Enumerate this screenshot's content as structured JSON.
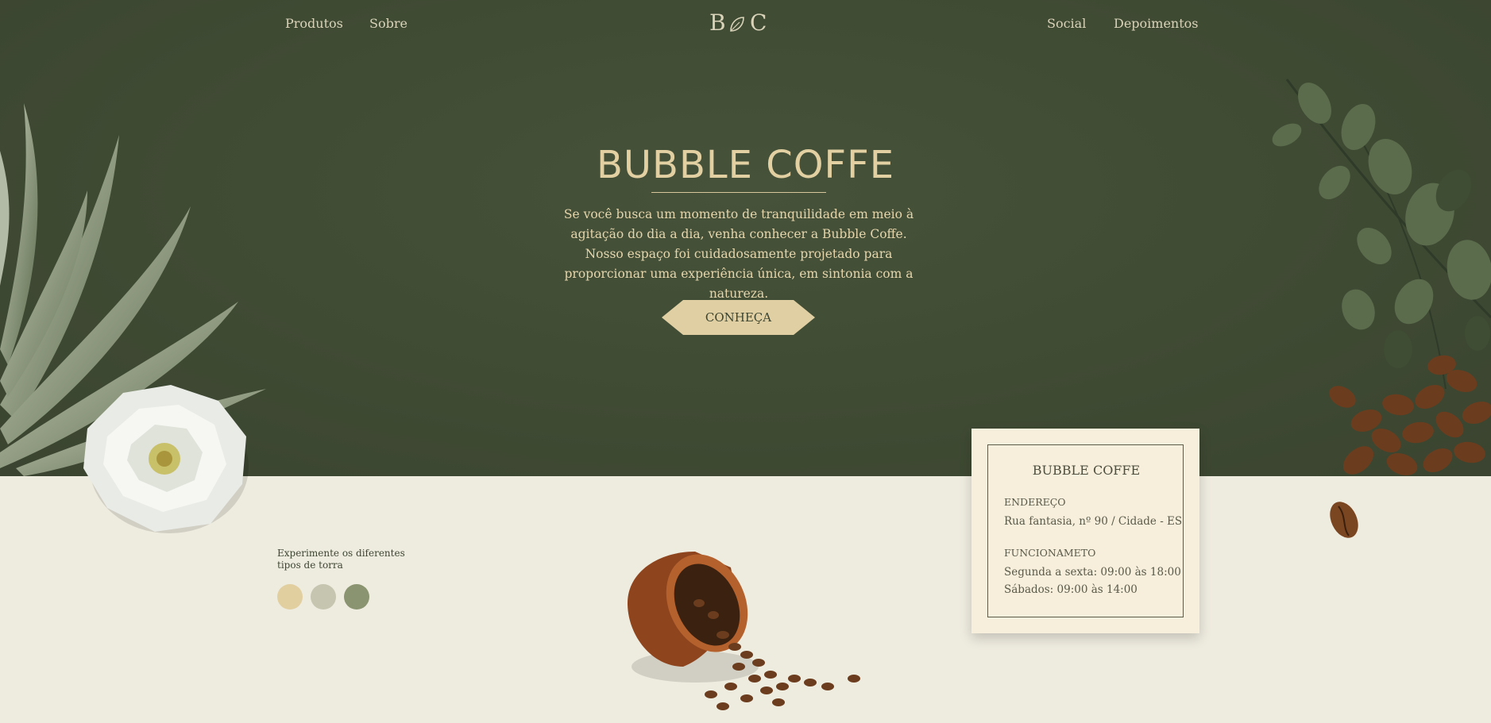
{
  "nav": {
    "left": [
      "Produtos",
      "Sobre"
    ],
    "right": [
      "Social",
      "Depoimentos"
    ],
    "logo_letters": [
      "B",
      "C"
    ]
  },
  "hero": {
    "title": "BUBBLE COFFE",
    "description": "Se você busca um momento de tranquilidade em meio à agitação do dia a dia, venha conhecer a Bubble Coffe. Nosso espaço foi cuidadosamente projetado para proporcionar uma experiência única, em sintonia com a natureza.",
    "cta_label": "CONHEÇA"
  },
  "roast": {
    "label": "Experimente os diferentes tipos de torra",
    "swatches": [
      "#e2cfa0",
      "#c5c5b0",
      "#8a9470"
    ]
  },
  "card": {
    "title": "BUBBLE COFFE",
    "address_heading": "ENDEREÇO",
    "address": "Rua fantasia, nº 90 / Cidade - ES",
    "hours_heading": "FUNCIONAMETO",
    "hours_weekdays": "Segunda a sexta: 09:00 às 18:00",
    "hours_saturday": "Sábados: 09:00 às 14:00"
  },
  "colors": {
    "hero_bg": "#3f4a33",
    "cream_bg": "#eeebdf",
    "accent": "#e2d0a2",
    "card_bg": "#f7efdc"
  },
  "icons": {
    "logo_leaf": "leaf-icon"
  }
}
